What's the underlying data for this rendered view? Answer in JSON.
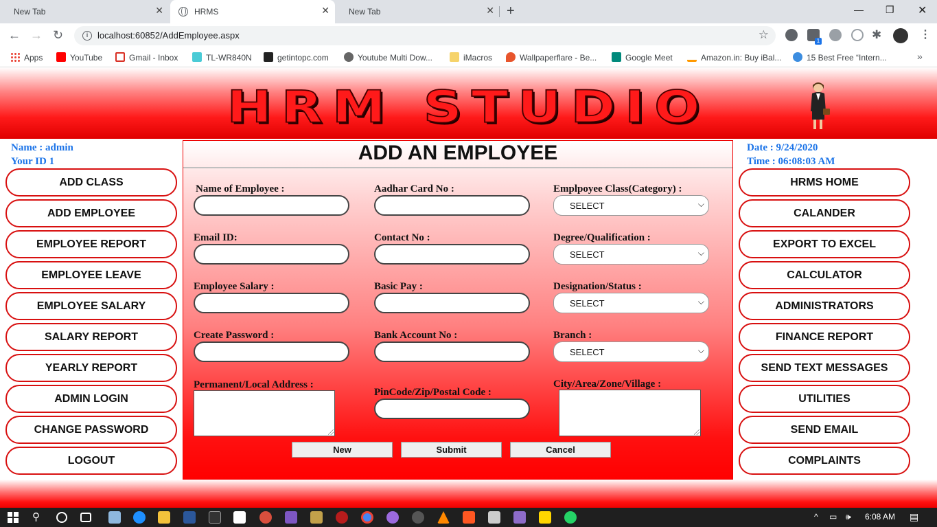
{
  "browser": {
    "tabs": [
      {
        "title": "New Tab",
        "active": false
      },
      {
        "title": "HRMS",
        "active": true
      },
      {
        "title": "New Tab",
        "active": false
      }
    ],
    "url": "localhost:60852/AddEmployee.aspx",
    "bookmarks": [
      "Apps",
      "YouTube",
      "Gmail - Inbox",
      "TL-WR840N",
      "getintopc.com",
      "Youtube Multi Dow...",
      "iMacros",
      "Wallpaperflare - Be...",
      "Google Meet",
      "Amazon.in: Buy iBal...",
      "15 Best Free “Intern..."
    ],
    "extension_badge": "1"
  },
  "header": {
    "logo_text": "HRM STUDIO"
  },
  "user": {
    "name_line": "Name :  admin",
    "id_line": "Your ID  1"
  },
  "clock": {
    "date_line": "Date :  9/24/2020",
    "time_line": "Time : 06:08:03 AM"
  },
  "left_menu": [
    "ADD CLASS",
    "ADD EMPLOYEE",
    "EMPLOYEE REPORT",
    "EMPLOYEE LEAVE",
    "EMPLOYEE SALARY",
    "SALARY REPORT",
    "YEARLY REPORT",
    "ADMIN LOGIN",
    "CHANGE PASSWORD",
    "LOGOUT"
  ],
  "right_menu": [
    "HRMS HOME",
    "CALANDER",
    "EXPORT TO EXCEL",
    "CALCULATOR",
    "ADMINISTRATORS",
    "FINANCE REPORT",
    "SEND TEXT MESSAGES",
    "UTILITIES",
    "SEND EMAIL",
    "COMPLAINTS"
  ],
  "form": {
    "title": "ADD AN EMPLOYEE",
    "labels": {
      "name": "Name of Employee :",
      "aadhar": "Aadhar Card No :",
      "emp_class": "Emplpoyee Class(Category) :",
      "email": "Email ID:",
      "contact": "Contact No :",
      "degree": "Degree/Qualification :",
      "salary": "Employee Salary :",
      "basic_pay": "Basic Pay :",
      "designation": "Designation/Status :",
      "password": "Create Password :",
      "bank": "Bank Account No :",
      "branch": "Branch :",
      "address": "Permanent/Local Address :",
      "pincode": "PinCode/Zip/Postal Code :",
      "city": "City/Area/Zone/Village :"
    },
    "select_value": "SELECT",
    "buttons": {
      "new": "New",
      "submit": "Submit",
      "cancel": "Cancel"
    }
  },
  "taskbar": {
    "time": "6:08 AM"
  }
}
